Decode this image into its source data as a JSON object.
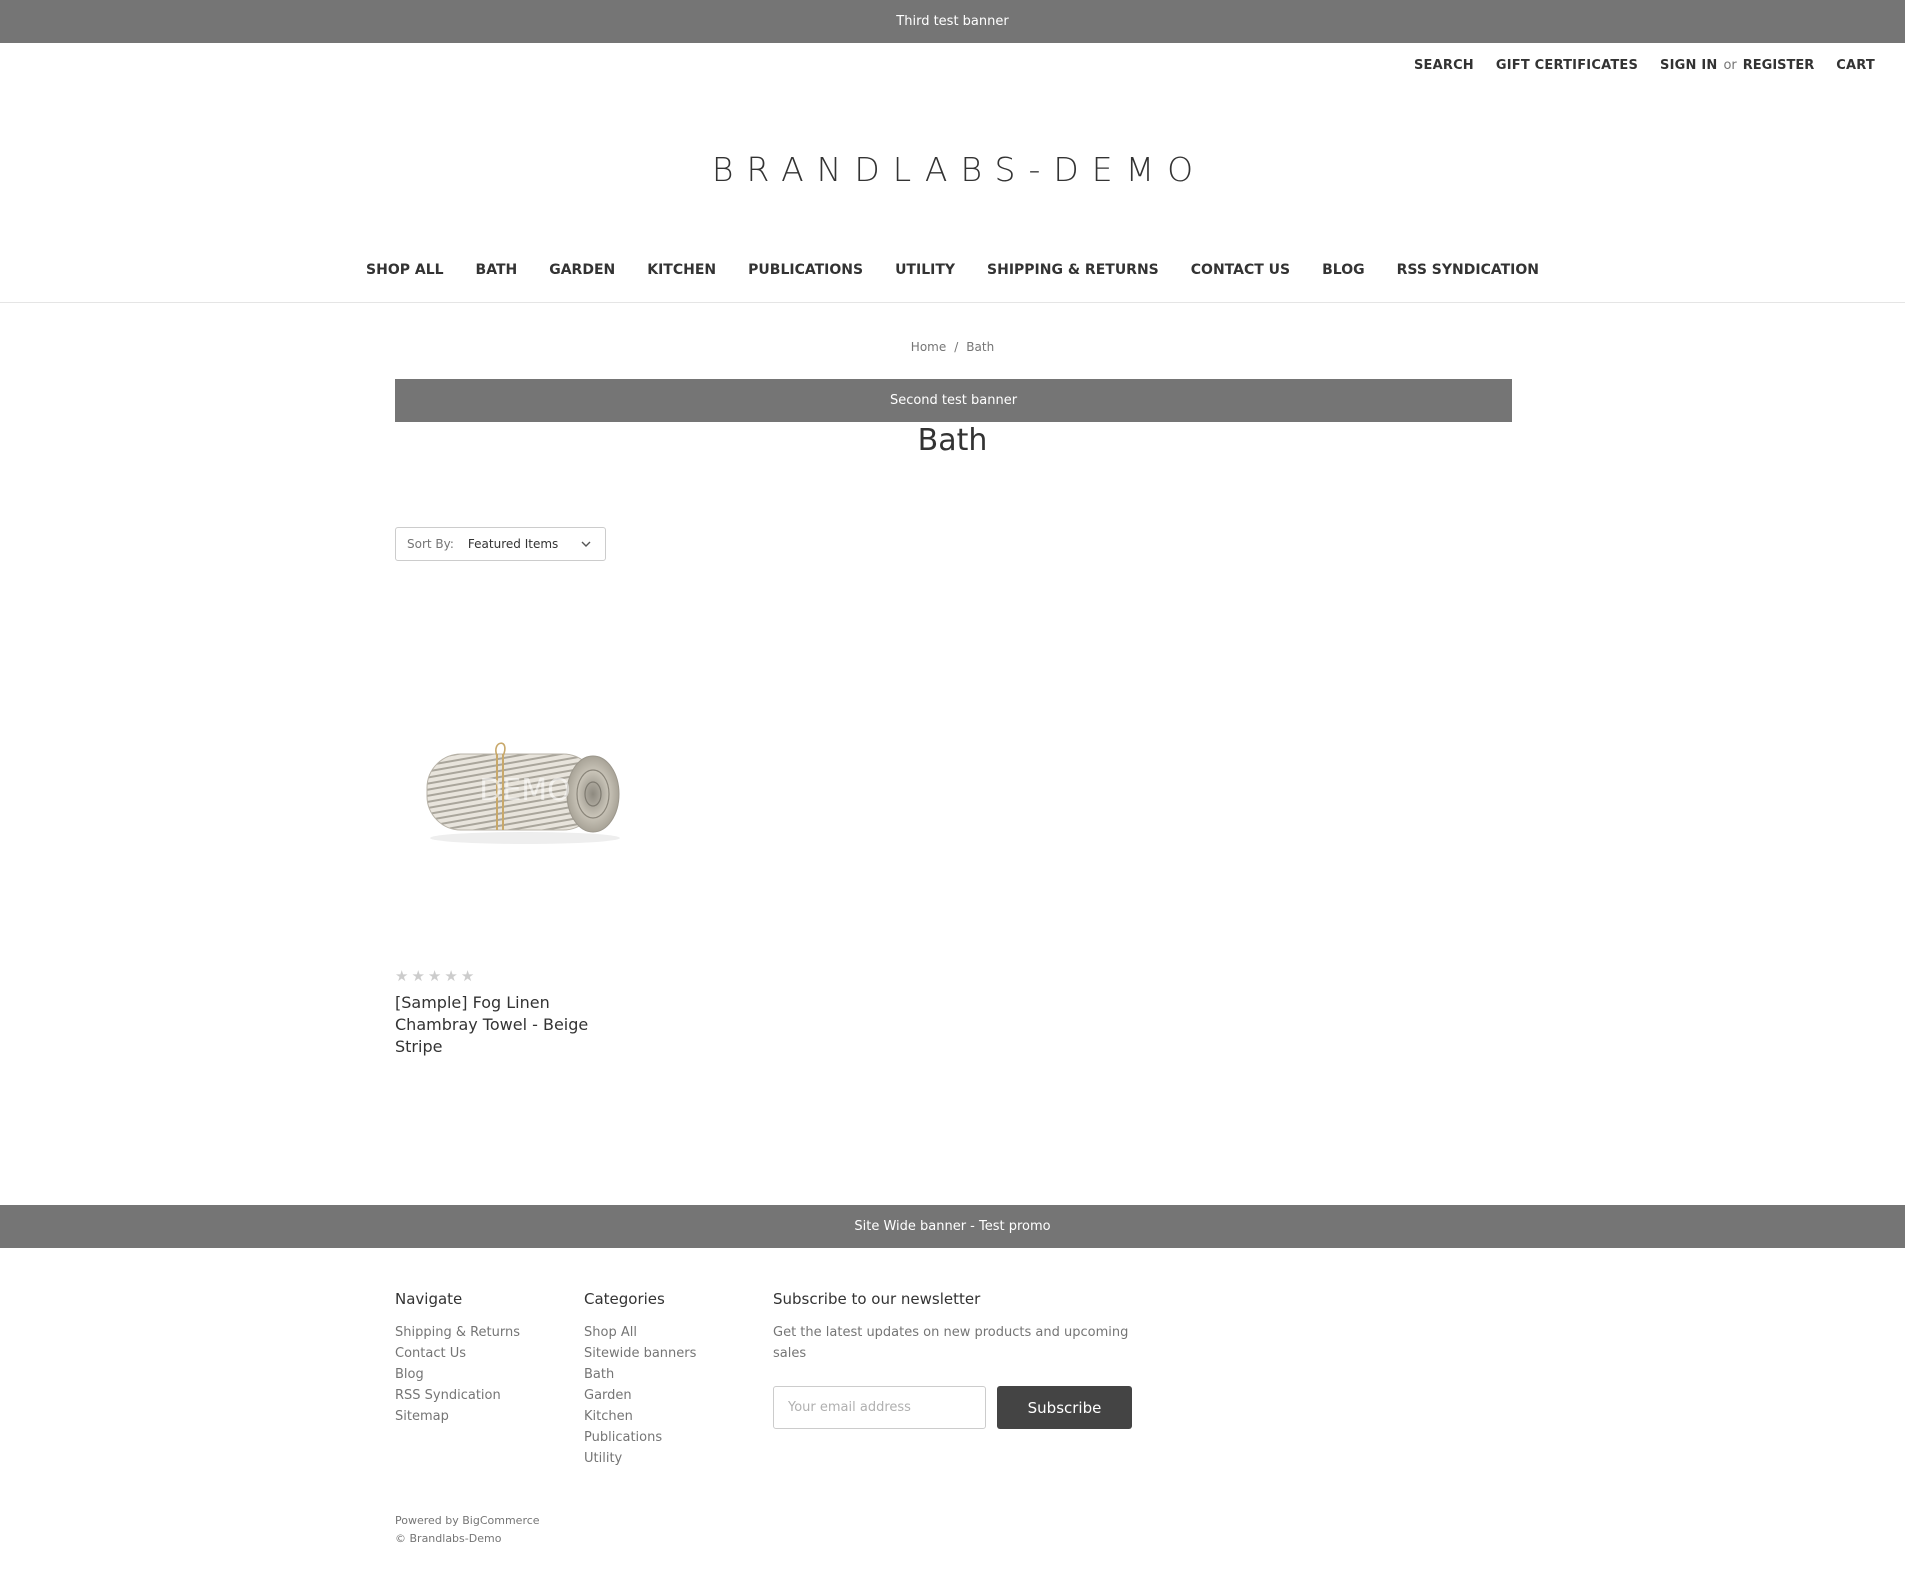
{
  "banners": {
    "top": "Third test banner",
    "second": "Second test banner",
    "footer": "Site Wide banner - Test promo"
  },
  "util_nav": {
    "search": "SEARCH",
    "gift_certificates": "GIFT CERTIFICATES",
    "sign_in": "SIGN IN",
    "or": "or",
    "register": "REGISTER",
    "cart": "CART"
  },
  "logo": "BRANDLABS-DEMO",
  "main_nav": [
    "SHOP ALL",
    "BATH",
    "GARDEN",
    "KITCHEN",
    "PUBLICATIONS",
    "UTILITY",
    "SHIPPING & RETURNS",
    "CONTACT US",
    "BLOG",
    "RSS SYNDICATION"
  ],
  "breadcrumb": {
    "home": "Home",
    "separator": "/",
    "current": "Bath"
  },
  "page_title": "Bath",
  "sort": {
    "label": "Sort By:",
    "value": "Featured Items"
  },
  "product": {
    "name": "[Sample] Fog Linen Chambray Towel - Beige Stripe",
    "rating": 0,
    "rating_max": 5,
    "image_watermark": "DEMO"
  },
  "footer": {
    "navigate": {
      "heading": "Navigate",
      "links": [
        "Shipping & Returns",
        "Contact Us",
        "Blog",
        "RSS Syndication",
        "Sitemap"
      ]
    },
    "categories": {
      "heading": "Categories",
      "links": [
        "Shop All",
        "Sitewide banners",
        "Bath",
        "Garden",
        "Kitchen",
        "Publications",
        "Utility"
      ]
    },
    "newsletter": {
      "heading": "Subscribe to our newsletter",
      "description": "Get the latest updates on new products and upcoming sales",
      "email_placeholder": "Your email address",
      "button": "Subscribe"
    },
    "powered_by": "Powered by BigCommerce",
    "copyright": "© Brandlabs-Demo"
  },
  "colors": {
    "banner": "#757575",
    "button": "#444444",
    "text": "#333333",
    "muted": "#757575"
  }
}
